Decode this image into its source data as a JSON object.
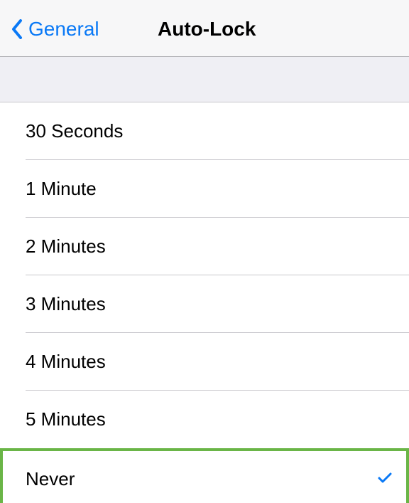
{
  "navbar": {
    "back_label": "General",
    "title": "Auto-Lock",
    "accent_color": "#0a79f6"
  },
  "options": [
    {
      "label": "30 Seconds",
      "selected": false
    },
    {
      "label": "1 Minute",
      "selected": false
    },
    {
      "label": "2 Minutes",
      "selected": false
    },
    {
      "label": "3 Minutes",
      "selected": false
    },
    {
      "label": "4 Minutes",
      "selected": false
    },
    {
      "label": "5 Minutes",
      "selected": false
    },
    {
      "label": "Never",
      "selected": true
    }
  ],
  "icons": {
    "back": "chevron-left-icon",
    "selected": "checkmark-icon"
  },
  "colors": {
    "selection_highlight": "#6ab547",
    "group_background": "#efeff4"
  }
}
